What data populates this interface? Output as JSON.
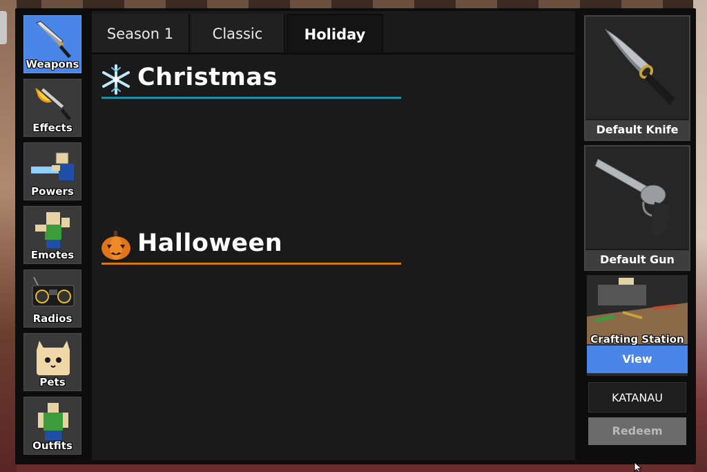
{
  "sidebar": {
    "items": [
      {
        "label": "Weapons",
        "icon": "knife-icon",
        "active": true
      },
      {
        "label": "Effects",
        "icon": "flame-knife-icon",
        "active": false
      },
      {
        "label": "Powers",
        "icon": "character-power-icon",
        "active": false
      },
      {
        "label": "Emotes",
        "icon": "character-emote-icon",
        "active": false
      },
      {
        "label": "Radios",
        "icon": "boombox-icon",
        "active": false
      },
      {
        "label": "Pets",
        "icon": "cat-pet-icon",
        "active": false
      },
      {
        "label": "Outfits",
        "icon": "character-outfit-icon",
        "active": false
      }
    ]
  },
  "tabs": [
    {
      "label": "Season 1",
      "active": false
    },
    {
      "label": "Classic",
      "active": false
    },
    {
      "label": "Holiday",
      "active": true
    }
  ],
  "sections": [
    {
      "title": "Christmas",
      "icon": "snowflake-icon",
      "line_color": "#1e8fa8"
    },
    {
      "title": "Halloween",
      "icon": "pumpkin-icon",
      "line_color": "#d4780f"
    }
  ],
  "equipped": {
    "knife": {
      "label": "Default Knife",
      "icon": "knife-icon"
    },
    "gun": {
      "label": "Default Gun",
      "icon": "revolver-icon"
    }
  },
  "crafting": {
    "label": "Crafting Station",
    "view_label": "View"
  },
  "redeem": {
    "code_value": "KATANAU",
    "button_label": "Redeem"
  },
  "colors": {
    "accent_blue": "#4a86e8",
    "panel_bg": "#1a1a1a"
  }
}
